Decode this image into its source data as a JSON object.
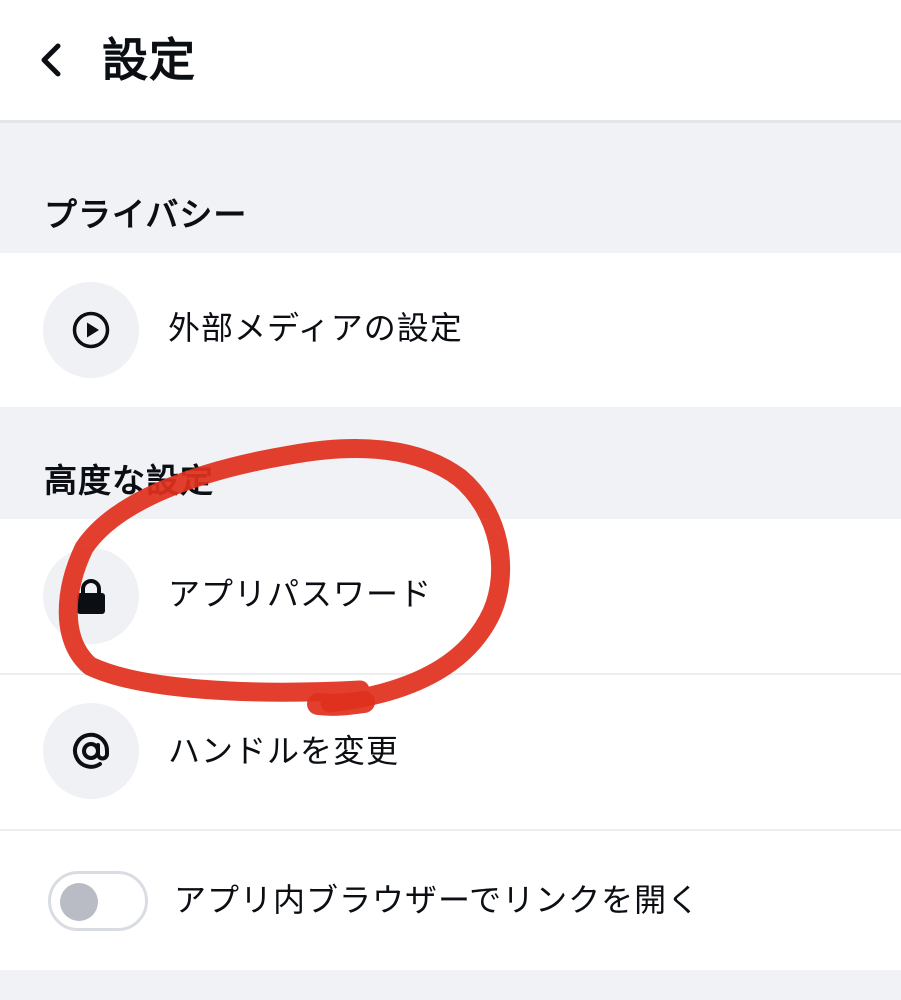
{
  "header": {
    "title": "設定",
    "back_icon": "chevron-left-icon"
  },
  "sections": {
    "privacy": {
      "heading": "プライバシー",
      "items": [
        {
          "label": "外部メディアの設定",
          "icon": "play-circle-icon"
        }
      ]
    },
    "advanced": {
      "heading": "高度な設定",
      "items": [
        {
          "label": "アプリパスワード",
          "icon": "lock-icon"
        },
        {
          "label": "ハンドルを変更",
          "icon": "at-sign-icon"
        },
        {
          "label": "アプリ内ブラウザーでリンクを開く",
          "control": "toggle",
          "checked": false
        }
      ]
    }
  },
  "annotation": {
    "type": "hand-drawn circle",
    "color": "#e0301e",
    "target": "アプリパスワード"
  },
  "colors": {
    "background": "#ffffff",
    "section_band": "#f1f2f6",
    "icon_circle": "#f0f1f5",
    "text": "#0b0f14",
    "toggle_knob_off": "#b9bcc4"
  }
}
